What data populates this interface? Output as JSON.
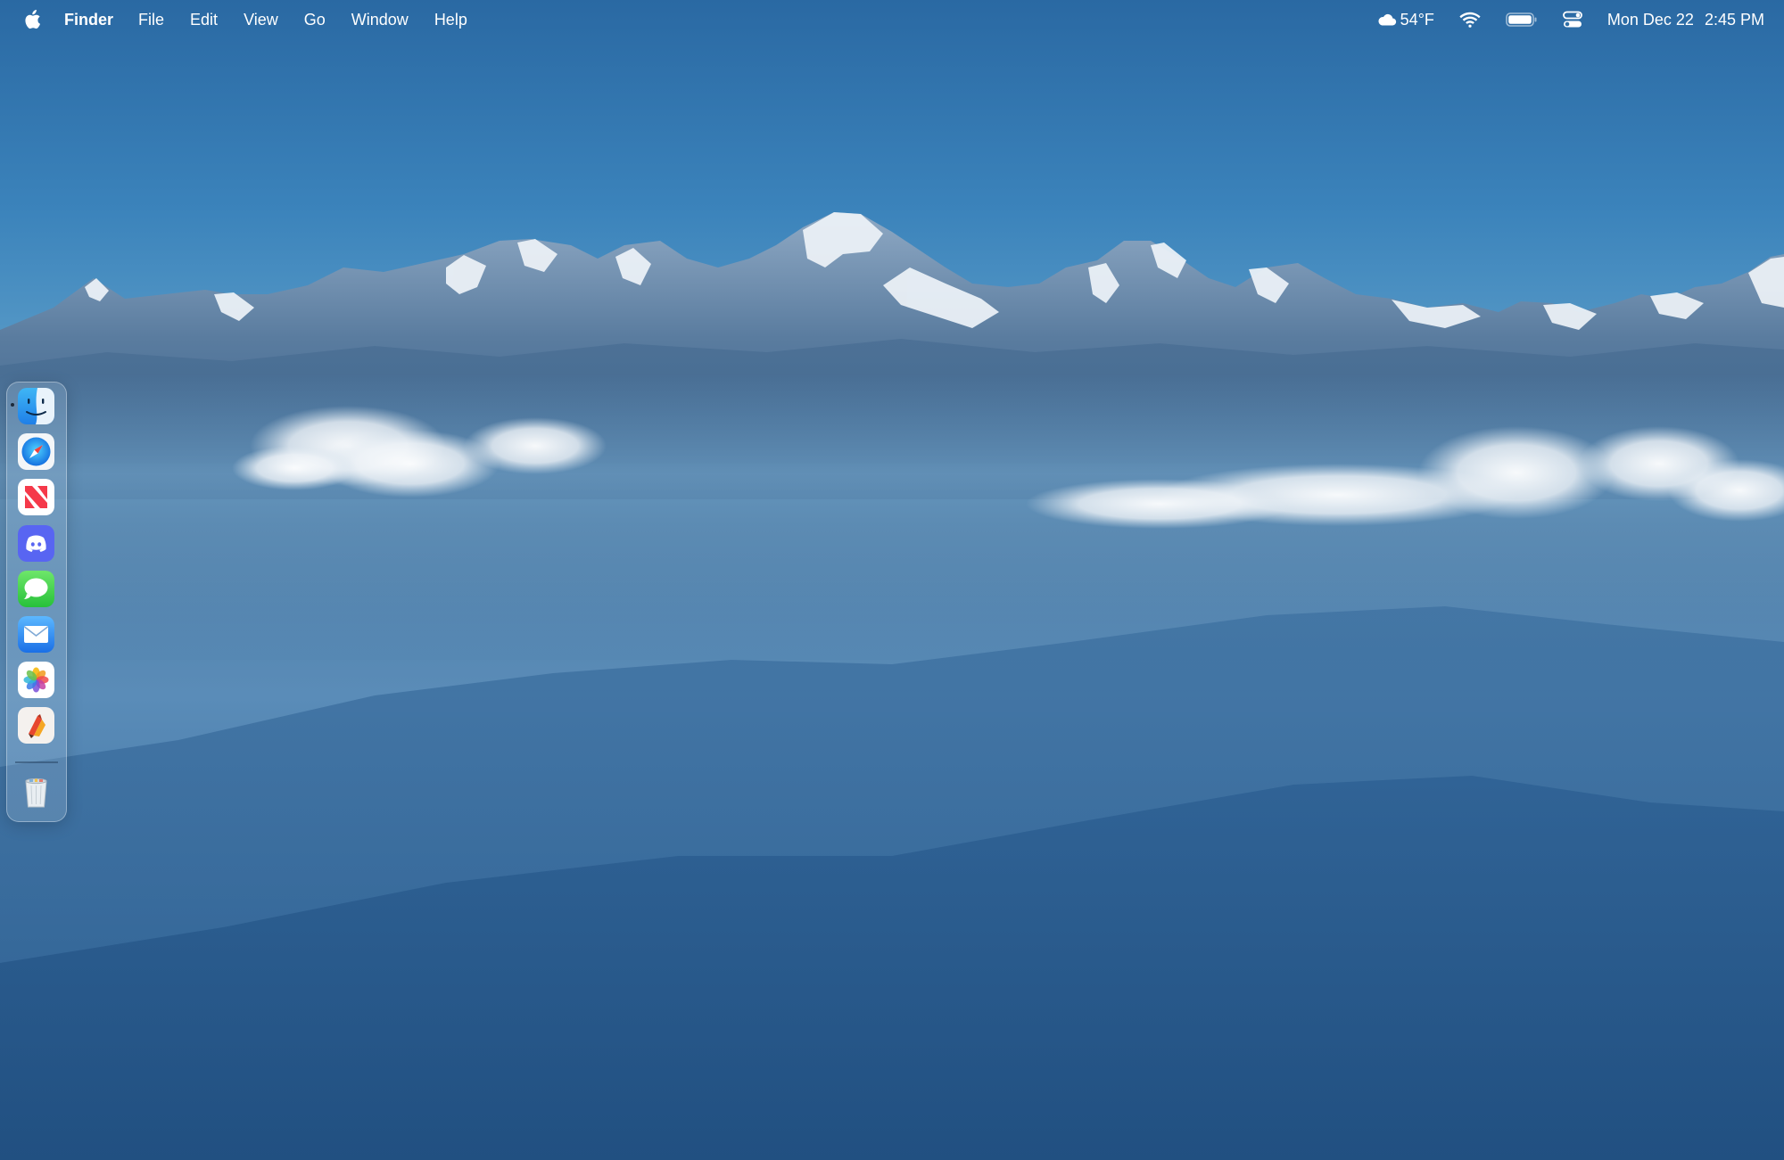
{
  "menubar": {
    "app_name": "Finder",
    "menus": [
      "File",
      "Edit",
      "View",
      "Go",
      "Window",
      "Help"
    ],
    "weather": "54°F",
    "date": "Mon Dec 22",
    "time": "2:45 PM"
  },
  "dock": {
    "apps": [
      "finder",
      "safari",
      "news",
      "discord",
      "messages",
      "mail",
      "photos",
      "pixelmator-pro"
    ],
    "running": [
      "finder"
    ],
    "trash": "trash"
  },
  "colors": {
    "sky_top": "#2a6aa3",
    "sky_mid": "#4c94c4",
    "haze": "#5d8db5",
    "valley_dark": "#1d4c7c",
    "menubar_text": "#ffffff"
  }
}
